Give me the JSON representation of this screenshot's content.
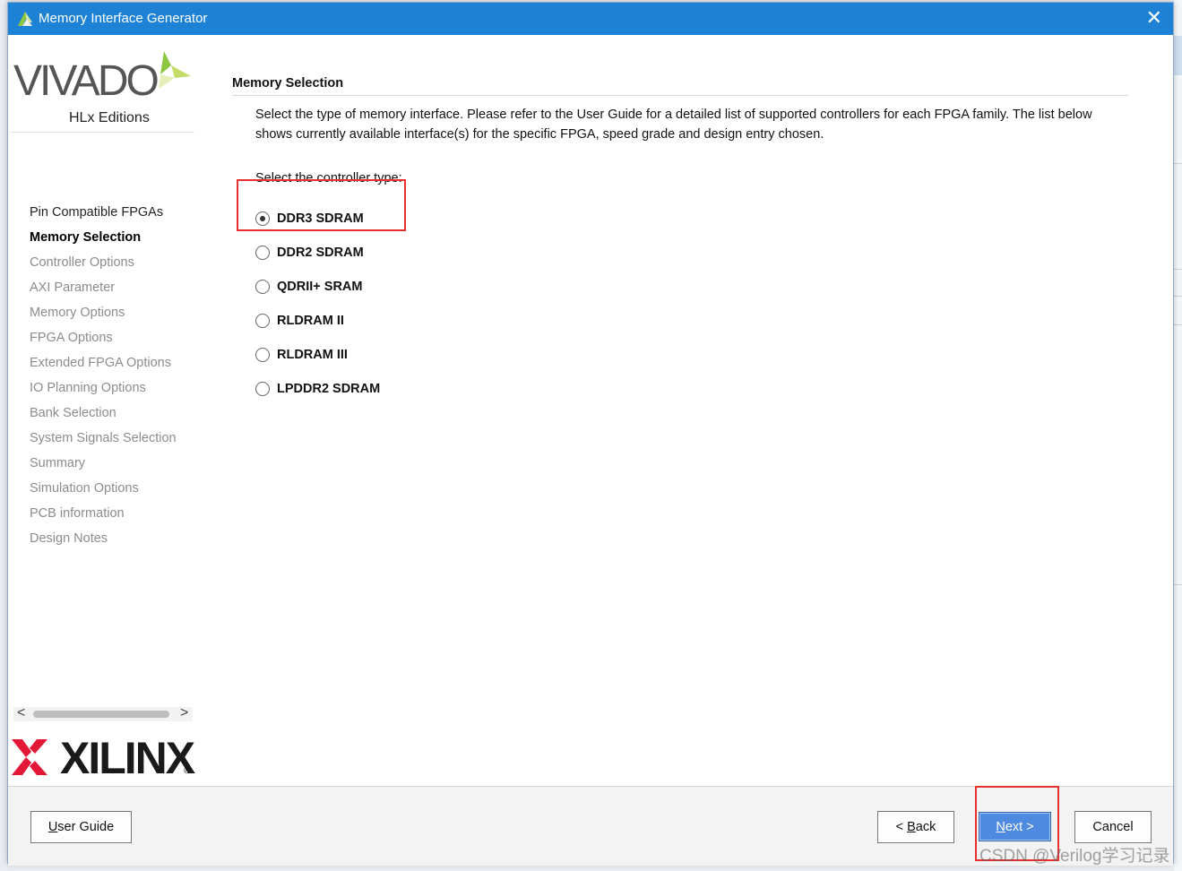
{
  "window": {
    "title": "Memory Interface Generator",
    "close_glyph": "✕"
  },
  "logos": {
    "vivado": "VIVADO",
    "hlx": "HLx Editions",
    "xilinx": "XILINX",
    "registered": "®"
  },
  "sidebar": {
    "steps": [
      {
        "label": "Pin Compatible FPGAs",
        "state": "done"
      },
      {
        "label": "Memory Selection",
        "state": "active"
      },
      {
        "label": "Controller Options",
        "state": "pending"
      },
      {
        "label": "AXI Parameter",
        "state": "pending"
      },
      {
        "label": "Memory Options",
        "state": "pending"
      },
      {
        "label": "FPGA Options",
        "state": "pending"
      },
      {
        "label": "Extended FPGA Options",
        "state": "pending"
      },
      {
        "label": "IO Planning Options",
        "state": "pending"
      },
      {
        "label": "Bank Selection",
        "state": "pending"
      },
      {
        "label": "System Signals Selection",
        "state": "pending"
      },
      {
        "label": "Summary",
        "state": "pending"
      },
      {
        "label": "Simulation Options",
        "state": "pending"
      },
      {
        "label": "PCB information",
        "state": "pending"
      },
      {
        "label": "Design Notes",
        "state": "pending"
      }
    ],
    "scroll_left": "<",
    "scroll_right": ">"
  },
  "main": {
    "section_title": "Memory Selection",
    "description": "Select the type of memory interface. Please refer to the User Guide for a detailed list of supported controllers for each FPGA family. The list below shows currently available interface(s) for the specific FPGA, speed grade and design entry chosen.",
    "controller_label": "Select the controller type:",
    "options": [
      {
        "label": "DDR3 SDRAM",
        "selected": true
      },
      {
        "label": "DDR2 SDRAM",
        "selected": false
      },
      {
        "label": "QDRII+ SRAM",
        "selected": false
      },
      {
        "label": "RLDRAM II",
        "selected": false
      },
      {
        "label": "RLDRAM III",
        "selected": false
      },
      {
        "label": "LPDDR2 SDRAM",
        "selected": false
      }
    ]
  },
  "footer": {
    "user_guide_first": "U",
    "user_guide_rest": "ser Guide",
    "back_prefix": "< ",
    "back_mnemonic": "B",
    "back_rest": "ack",
    "next_mnemonic": "N",
    "next_rest": "ext >",
    "cancel": "Cancel"
  },
  "watermark": "CSDN @Verilog学习记录",
  "colors": {
    "titlebar": "#1d82d5",
    "highlight": "#e8312f",
    "primary_button": "#4d8ae0",
    "vivado_green": "#8dc63f",
    "xilinx_red": "#e31837"
  }
}
